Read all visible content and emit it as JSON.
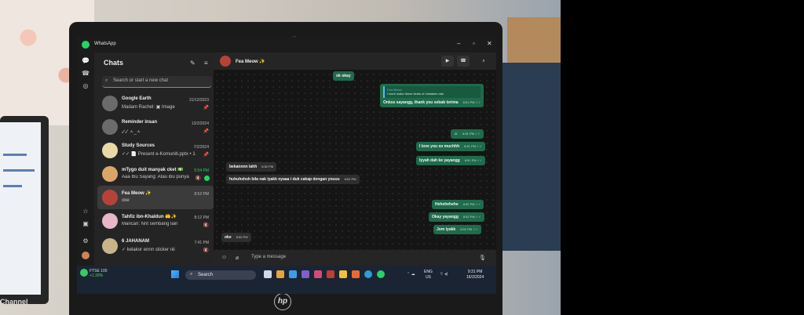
{
  "app": {
    "title": "WhatsApp"
  },
  "window": {
    "minimize": "–",
    "maximize": "▫",
    "close": "✕"
  },
  "chats_panel": {
    "title": "Chats",
    "search_placeholder": "Search or start a new chat",
    "items": [
      {
        "name": "Google Earth",
        "preview": "Madam Rachel: ▣ Image",
        "time": "31/12/2023",
        "meta": "📌"
      },
      {
        "name": "Reminder insan",
        "preview": "✓✓ ㅅ_ㅅ",
        "time": "13/2/2024",
        "meta": "📌"
      },
      {
        "name": "Study Sources",
        "preview": "✓✓ 📄 Present e-Komuniti.pptx • 14 pa...",
        "time": "7/2/2024",
        "meta": "📌"
      },
      {
        "name": "mTygo duit manyak cket 💵",
        "preview": "Aaa Ibu Sayang: Atau ibu punya",
        "time": "5:54 PM",
        "meta": "🔇"
      },
      {
        "name": "Fea Meow ✨",
        "preview": "oke",
        "time": "8:52 PM",
        "meta": ""
      },
      {
        "name": "Tahfiz ibn-Khaldun 🤲✨",
        "preview": "Marican: Nnt sembang lain",
        "time": "8:12 PM",
        "meta": "🔇"
      },
      {
        "name": "6 JAHANAM",
        "preview": "✓ kelakor ennn sticker nii",
        "time": "7:41 PM",
        "meta": "🔇"
      }
    ]
  },
  "conversation": {
    "contact": "Fea Meow ✨",
    "messages": [
      {
        "dir": "out",
        "text": "ok okay",
        "time": ""
      },
      {
        "dir": "out",
        "quote_name": "Fea Meow",
        "quote_text": "I wont make these kinds of mistakes dah",
        "text": "Onkss sayangg, thank you sebab terima",
        "time": "8:51 PM ✓✓"
      },
      {
        "dir": "out",
        "text": "☺",
        "time": "8:51 PM ✓✓"
      },
      {
        "dir": "out",
        "text": "I love you so muchhh",
        "time": "8:51 PM ✓✓"
      },
      {
        "dir": "out",
        "text": "Iyyah dah ke yayangg",
        "time": "8:51 PM ✓✓"
      },
      {
        "dir": "in",
        "text": "bekannnn lahh",
        "time": "8:52 PM"
      },
      {
        "dir": "in",
        "text": "huhuhshsh bila nak iyakk nyaaa i duk cakap dengan youuu",
        "time": "8:52 PM"
      },
      {
        "dir": "out",
        "text": "Hehehehehe",
        "time": "8:52 PM ✓✓"
      },
      {
        "dir": "out",
        "text": "Okay yayangg",
        "time": "8:52 PM ✓✓"
      },
      {
        "dir": "out",
        "text": "Jom iyakk",
        "time": "8:52 PM ✓✓"
      },
      {
        "dir": "in",
        "text": "oke",
        "time": "8:52 PM"
      }
    ],
    "composer_placeholder": "Type a message"
  },
  "taskbar": {
    "widget_label": "FTSE 100",
    "widget_value": "+1.33%",
    "search_label": "Search",
    "lang_line1": "ENG",
    "lang_line2": "US",
    "time": "9:31 PM",
    "date": "16/2/2024"
  },
  "device": {
    "brand": "hp"
  },
  "background": {
    "tablet_label": "Channel"
  }
}
